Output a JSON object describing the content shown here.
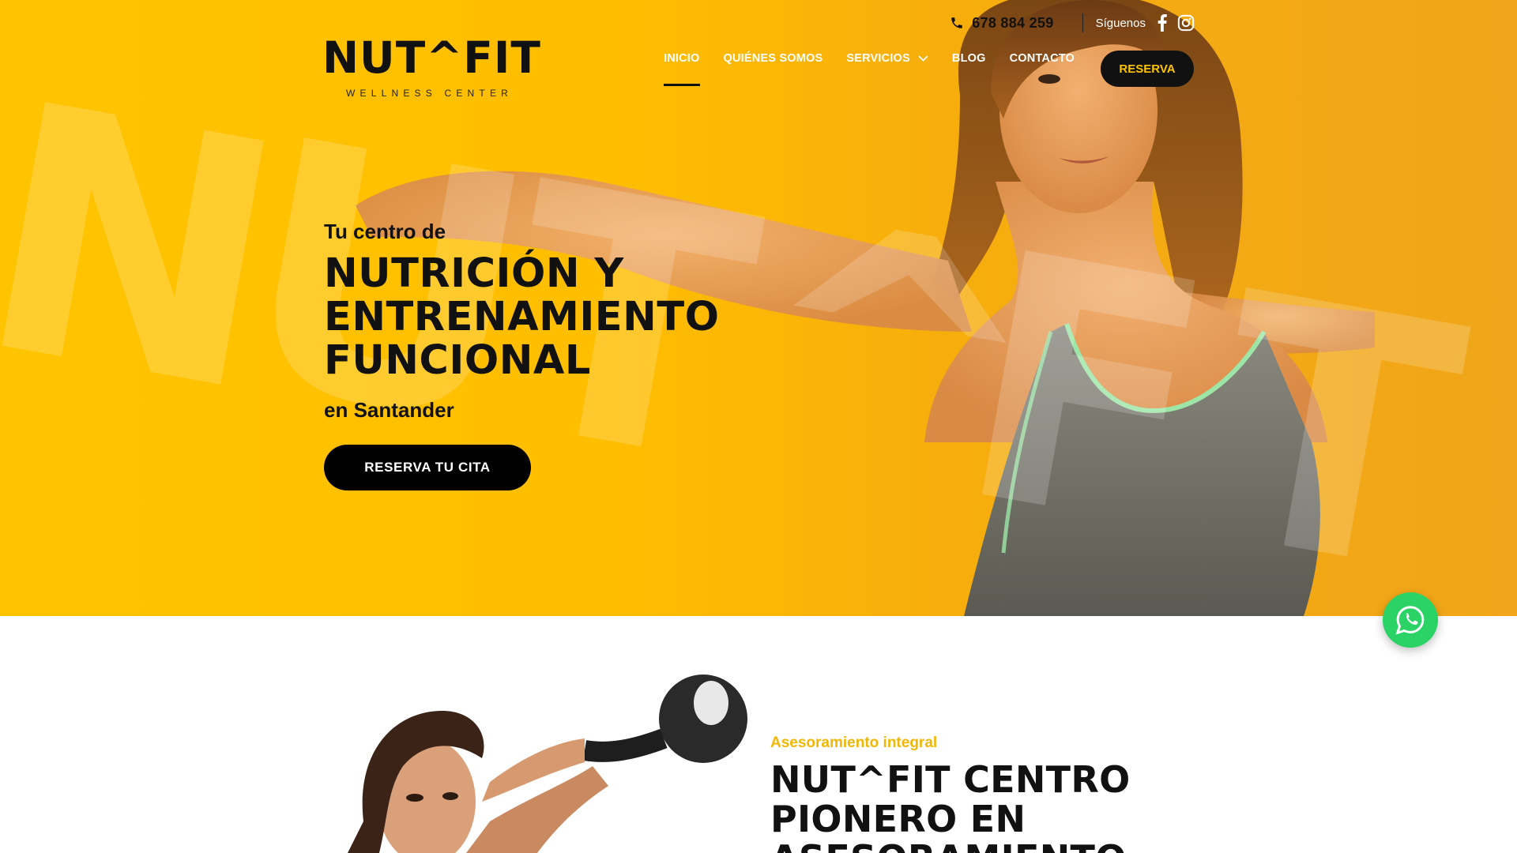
{
  "header": {
    "phone": "678 884 259",
    "follow_label": "Síguenos",
    "logo": {
      "main": "NUT^FIT",
      "sub": "WELLNESS CENTER"
    },
    "nav": [
      {
        "label": "INICIO",
        "active": true
      },
      {
        "label": "QUIÉNES SOMOS",
        "active": false
      },
      {
        "label": "SERVICIOS",
        "active": false,
        "has_dropdown": true
      },
      {
        "label": "BLOG",
        "active": false
      },
      {
        "label": "CONTACTO",
        "active": false
      }
    ],
    "cta": "RESERVA",
    "social_icons": [
      "facebook-icon",
      "instagram-icon"
    ]
  },
  "hero": {
    "kicker": "Tu centro de",
    "title_lines": [
      "NUTRICIÓN Y",
      "ENTRENAMIENTO",
      "FUNCIONAL"
    ],
    "subtitle": "en Santander",
    "button": "RESERVA TU CITA",
    "background_letters": "NUT^FIT"
  },
  "section2": {
    "kicker": "Asesoramiento integral",
    "title_lines": [
      "NUT^FIT CENTRO",
      "PIONERO EN",
      "ASESORAMIENTO"
    ]
  },
  "colors": {
    "brand_yellow": "#ffc400",
    "black": "#111111",
    "whatsapp_green": "#2bd366"
  }
}
